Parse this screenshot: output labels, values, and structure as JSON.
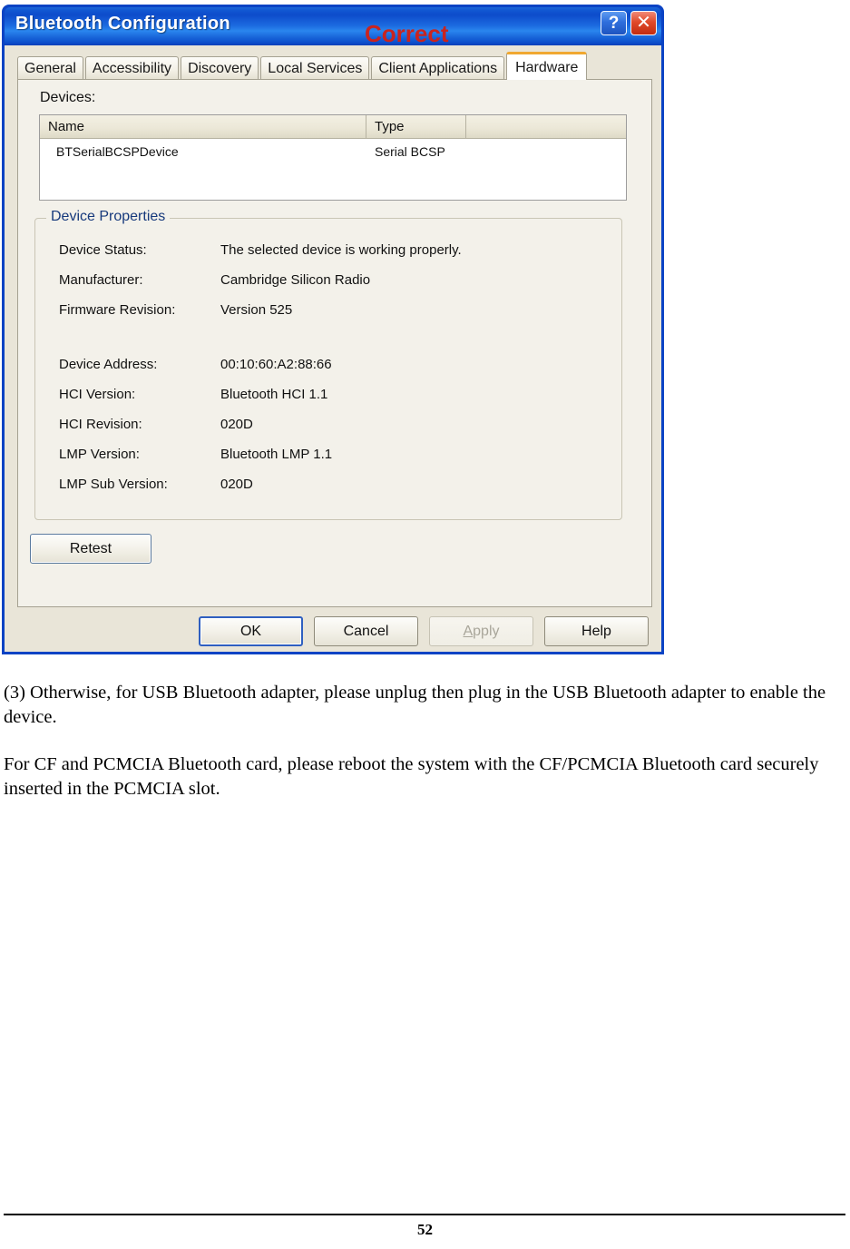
{
  "window": {
    "title": "Bluetooth Configuration",
    "annotation": "Correct",
    "help_button": "?",
    "close_button": "✕"
  },
  "tabs": [
    {
      "label": "General",
      "active": false
    },
    {
      "label": "Accessibility",
      "active": false
    },
    {
      "label": "Discovery",
      "active": false
    },
    {
      "label": "Local Services",
      "active": false
    },
    {
      "label": "Client Applications",
      "active": false
    },
    {
      "label": "Hardware",
      "active": true
    }
  ],
  "devices_section": {
    "label": "Devices:",
    "columns": [
      "Name",
      "Type",
      ""
    ],
    "rows": [
      {
        "name": "BTSerialBCSPDevice",
        "type": "Serial BCSP"
      }
    ]
  },
  "device_properties": {
    "legend": "Device Properties",
    "rows": [
      {
        "label": "Device Status:",
        "value": "The selected device is working properly."
      },
      {
        "label": "Manufacturer:",
        "value": "Cambridge Silicon Radio"
      },
      {
        "label": "Firmware Revision:",
        "value": "Version 525"
      },
      {
        "label": "Device Address:",
        "value": "00:10:60:A2:88:66"
      },
      {
        "label": "HCI Version:",
        "value": "Bluetooth HCI 1.1"
      },
      {
        "label": "HCI Revision:",
        "value": "020D"
      },
      {
        "label": "LMP Version:",
        "value": "Bluetooth LMP 1.1"
      },
      {
        "label": "LMP Sub Version:",
        "value": "020D"
      }
    ]
  },
  "buttons": {
    "retest": "Retest",
    "ok": "OK",
    "cancel": "Cancel",
    "apply_accel": "A",
    "apply_rest": "pply",
    "help": "Help"
  },
  "document": {
    "paragraph_1": "(3) Otherwise, for USB Bluetooth adapter, please unplug then plug in the USB Bluetooth adapter to enable the device.",
    "paragraph_2": "For CF and PCMCIA Bluetooth card, please reboot the system with the CF/PCMCIA Bluetooth card securely inserted in the PCMCIA slot.",
    "page_number": "52"
  },
  "colors": {
    "titlebar_blue": "#0b43c4",
    "annotation_red": "#c9241f",
    "active_tab_top": "#f0a830",
    "groupbox_legend": "#16397c",
    "dialog_face": "#e9e5d8"
  }
}
